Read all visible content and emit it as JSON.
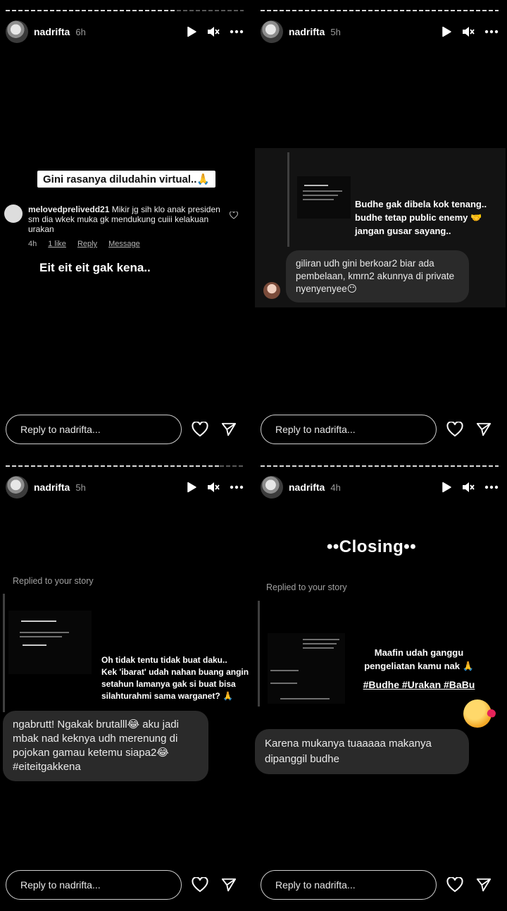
{
  "reply_placeholder": "Reply to nadrifta...",
  "stories": [
    {
      "username": "nadrifta",
      "time": "6h",
      "caption": "Gini rasanya diludahin virtual..🙏",
      "comment": {
        "user": "melovedprelivedd21",
        "text": "Mikir jg sih klo anak presiden sm dia wkek muka gk mendukung cuiii kelakuan urakan",
        "time": "4h",
        "likes": "1 like",
        "reply": "Reply",
        "message": "Message"
      },
      "text": "Eit eit eit gak kena.."
    },
    {
      "username": "nadrifta",
      "time": "5h",
      "overlay_text": [
        "Budhe gak dibela kok tenang..",
        "budhe tetap public enemy 🤝",
        "jangan gusar sayang.."
      ],
      "message": "giliran udh gini berkoar2 biar ada pembelaan, kmrn2 akunnya di private nyenyenyee😶"
    },
    {
      "username": "nadrifta",
      "time": "5h",
      "replied_label": "Replied to your story",
      "overlay_text": [
        "Oh tidak tentu tidak buat daku..",
        "Kek 'ibarat' udah nahan buang angin",
        "setahun lamanya gak si buat bisa",
        "silahturahmi sama warganet? 🙏"
      ],
      "message": "ngabrutt! Ngakak brutalll😂 aku jadi mbak nad keknya udh merenung di pojokan gamau ketemu siapa2😂 #eiteitgakkena"
    },
    {
      "username": "nadrifta",
      "time": "4h",
      "heading": "••Closing••",
      "replied_label": "Replied to your story",
      "overlay_text": [
        "Maafin udah ganggu",
        "pengeliatan kamu nak 🙏"
      ],
      "hashtags": "#Budhe #Urakan #BaBu",
      "message": "Karena mukanya tuaaaaa makanya dipanggil budhe"
    }
  ]
}
